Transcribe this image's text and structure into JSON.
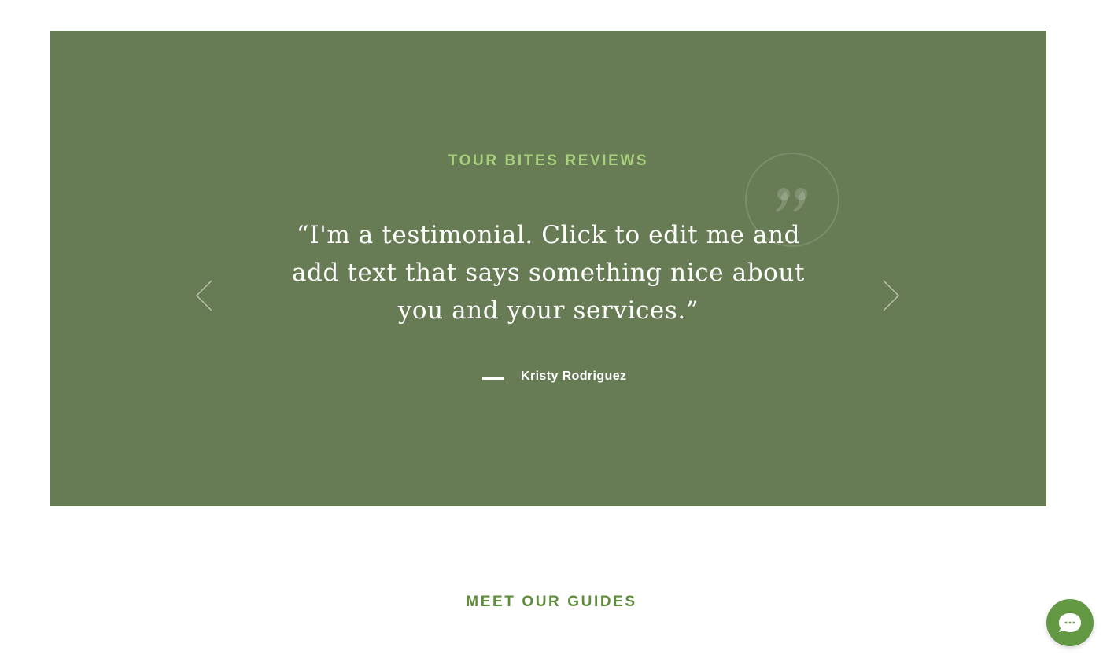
{
  "reviews": {
    "title": "TOUR BITES REVIEWS",
    "testimonial": "“I'm a testimonial. Click to edit me and add text that says something nice about you and your services.”",
    "author": "Kristy Rodriguez",
    "prev_icon": "chevron-left-icon",
    "next_icon": "chevron-right-icon",
    "quote_icon": "quote-icon",
    "background_color": "#677c55",
    "title_color": "#a8d07c"
  },
  "guides": {
    "title": "MEET OUR GUIDES",
    "title_color": "#5f8c3c"
  },
  "chat": {
    "icon": "chat-bubble-icon",
    "color": "#629942"
  }
}
